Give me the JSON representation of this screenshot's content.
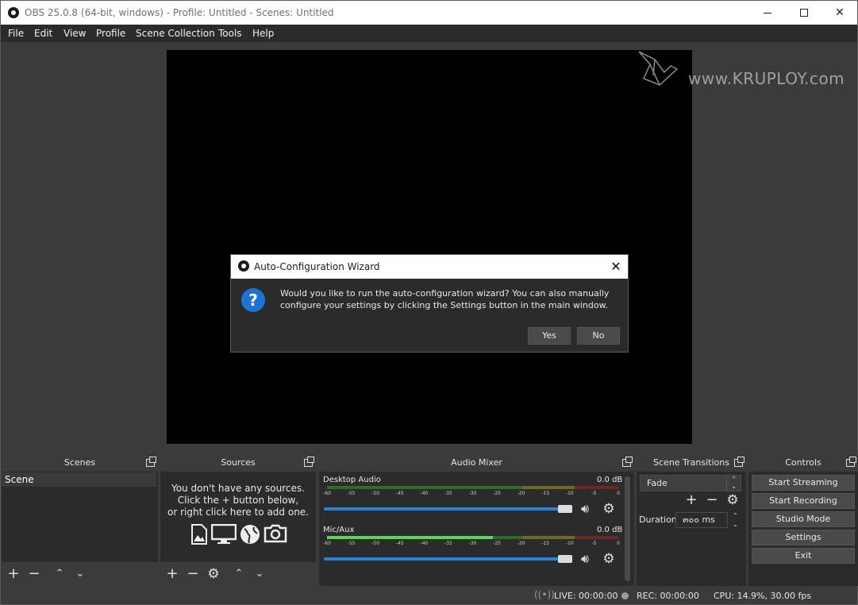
{
  "window": {
    "title": "OBS 25.0.8 (64-bit, windows) - Profile: Untitled - Scenes: Untitled",
    "minimize": "—",
    "maximize": "☐",
    "close": "✕"
  },
  "menu": [
    "File",
    "Edit",
    "View",
    "Profile",
    "Scene Collection",
    "Tools",
    "Help"
  ],
  "watermark": {
    "text": "www.KRUPLOY.com"
  },
  "dialog": {
    "title": "Auto-Configuration Wizard",
    "icon": "?",
    "message_line1": "Would you like to run the auto-configuration wizard? You can also manually",
    "message_line2": "configure your settings by clicking the Settings button in the main window.",
    "yes": "Yes",
    "no": "No",
    "close": "✕"
  },
  "docks": {
    "scenes": {
      "title": "Scenes",
      "items": [
        "Scene"
      ]
    },
    "sources": {
      "title": "Sources",
      "hint_line1": "You don't have any sources.",
      "hint_line2": "Click the + button below,",
      "hint_line3": "or right click here to add one."
    },
    "mixer": {
      "title": "Audio Mixer",
      "ticks": [
        "-60",
        "-55",
        "-50",
        "-45",
        "-40",
        "-35",
        "-30",
        "-25",
        "-20",
        "-15",
        "-10",
        "-5",
        "0"
      ],
      "channels": [
        {
          "name": "Desktop Audio",
          "db": "0.0 dB"
        },
        {
          "name": "Mic/Aux",
          "db": "0.0 dB"
        }
      ]
    },
    "transitions": {
      "title": "Scene Transitions",
      "selected": "Fade",
      "duration_label": "Duration",
      "duration_value": "๓๐๐ ms"
    },
    "controls": {
      "title": "Controls",
      "buttons": [
        "Start Streaming",
        "Start Recording",
        "Studio Mode",
        "Settings",
        "Exit"
      ]
    }
  },
  "status": {
    "live": "LIVE: 00:00:00",
    "rec": "REC: 00:00:00",
    "cpu": "CPU: 14.9%, 30.00 fps"
  },
  "colors": {
    "background": "#3b3b3b",
    "panel": "#2b2b2b",
    "accent": "#2a82da",
    "meter_green": "#5fd35f",
    "dialog_icon": "#1e74d6"
  }
}
